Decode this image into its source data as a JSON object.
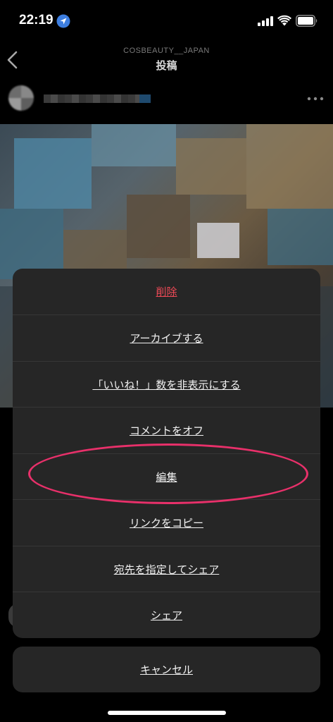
{
  "status_bar": {
    "time": "22:19"
  },
  "nav": {
    "account": "COSBEAUTY__JAPAN",
    "title": "投稿"
  },
  "menu": {
    "items": [
      {
        "label": "削除"
      },
      {
        "label": "アーカイブする"
      },
      {
        "label": "「いいね！」数を非表示にする"
      },
      {
        "label": "コメントをオフ"
      },
      {
        "label": "編集"
      },
      {
        "label": "リンクをコピー"
      },
      {
        "label": "宛先を指定してシェア"
      },
      {
        "label": "シェア"
      }
    ],
    "cancel_label": "キャンセル"
  },
  "colors": {
    "danger": "#ed4956",
    "highlight": "#e8306a",
    "sheet_bg": "#262626"
  }
}
